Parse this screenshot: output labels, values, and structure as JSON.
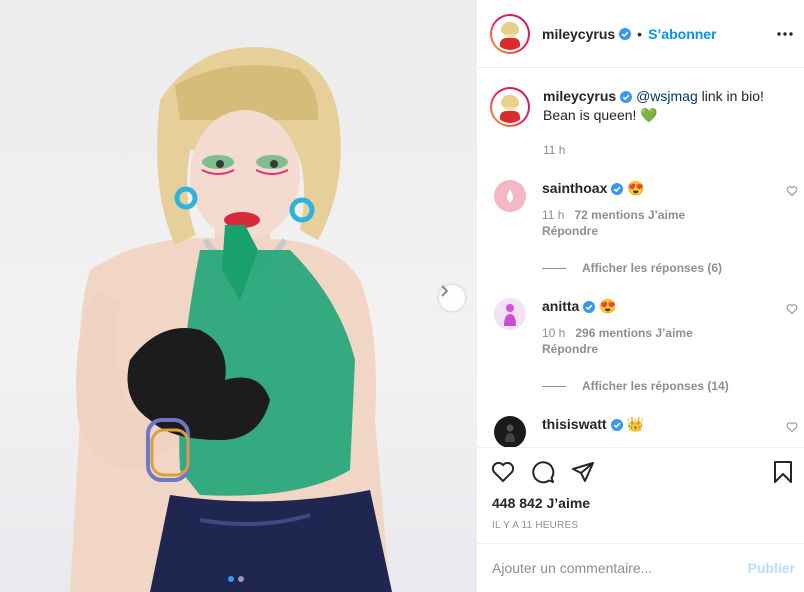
{
  "post": {
    "username": "mileycyrus",
    "follow_label": "S’abonner",
    "separator": "•",
    "more_icon": "more-horizontal-icon"
  },
  "caption": {
    "username": "mileycyrus",
    "mention": "@wsjmag",
    "text_after_mention": " link in bio!",
    "line2": "Bean is queen!",
    "emoji": "💚",
    "time": "11 h"
  },
  "comments": [
    {
      "username": "sainthoax",
      "emoji": "😍",
      "time": "11 h",
      "likes": "72 mentions J’aime",
      "reply": "Répondre",
      "view_replies": "Afficher les réponses (6)",
      "avatar_color": "#f2b8c6"
    },
    {
      "username": "anitta",
      "emoji": "😍",
      "time": "10 h",
      "likes": "296 mentions J’aime",
      "reply": "Répondre",
      "view_replies": "Afficher les réponses (14)",
      "avatar_color": "#e7b7f0"
    },
    {
      "username": "thisiswatt",
      "emoji": "👑",
      "avatar_color": "#1a1a1a"
    }
  ],
  "actions": {
    "likes": "448 842 J’aime",
    "ago": "IL Y A 11 HEURES",
    "icons": [
      "heart-icon",
      "comment-icon",
      "share-icon",
      "bookmark-icon"
    ]
  },
  "add_comment": {
    "placeholder": "Ajouter un commentaire...",
    "publish_label": "Publier"
  },
  "carousel": {
    "slides_shown": 2,
    "active_index": 0,
    "accent_color": "#3897f0"
  },
  "colors": {
    "link": "#0095f6",
    "mention": "#00376b",
    "muted": "#8e8e8e",
    "publish_disabled": "#b2dffc"
  }
}
